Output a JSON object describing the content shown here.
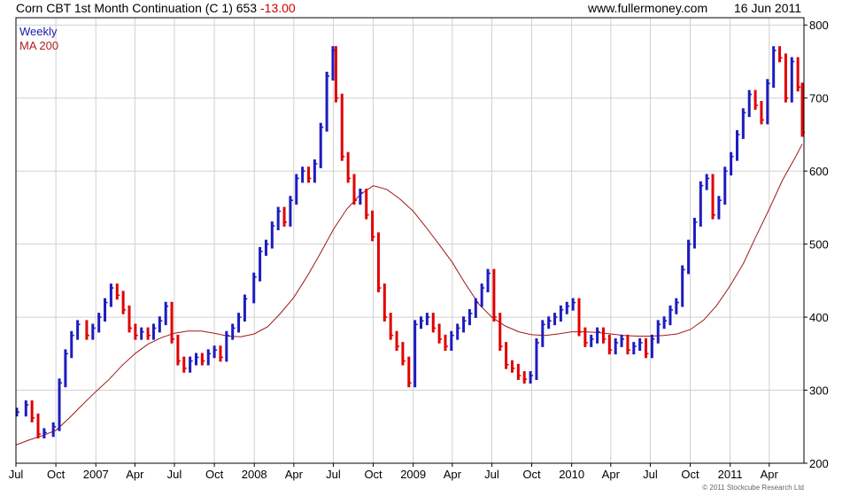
{
  "header": {
    "title": "Corn CBT 1st Month Continuation (C 1) 653",
    "change": "-13.00",
    "site": "www.fullermoney.com",
    "date": "16 Jun 2011"
  },
  "footer": {
    "copyright": "© 2011 Stockcube Research Ltd"
  },
  "colors": {
    "up": "#1c1cc0",
    "down": "#e00000",
    "ma": "#a01818",
    "grid": "#d0d0d0",
    "frame": "#000000"
  },
  "chart_data": {
    "type": "ohlc",
    "legend": [
      "Weekly",
      "MA 200"
    ],
    "legend_position": "top-left",
    "grid": true,
    "y_axis_side": "right",
    "ylim": [
      200,
      810
    ],
    "yticks": [
      200,
      300,
      400,
      500,
      600,
      700,
      800
    ],
    "xlim": [
      "2006-07-01",
      "2011-06-20"
    ],
    "xticks": [
      {
        "label": "Jul",
        "date": "2006-07-01"
      },
      {
        "label": "Oct",
        "date": "2006-10-01"
      },
      {
        "label": "2007",
        "date": "2007-01-01"
      },
      {
        "label": "Apr",
        "date": "2007-04-01"
      },
      {
        "label": "Jul",
        "date": "2007-07-01"
      },
      {
        "label": "Oct",
        "date": "2007-10-01"
      },
      {
        "label": "2008",
        "date": "2008-01-01"
      },
      {
        "label": "Apr",
        "date": "2008-04-01"
      },
      {
        "label": "Jul",
        "date": "2008-07-01"
      },
      {
        "label": "Oct",
        "date": "2008-10-01"
      },
      {
        "label": "2009",
        "date": "2009-01-01"
      },
      {
        "label": "Apr",
        "date": "2009-04-01"
      },
      {
        "label": "Jul",
        "date": "2009-07-01"
      },
      {
        "label": "Oct",
        "date": "2009-10-01"
      },
      {
        "label": "2010",
        "date": "2010-01-01"
      },
      {
        "label": "Apr",
        "date": "2010-04-01"
      },
      {
        "label": "Jul",
        "date": "2010-07-01"
      },
      {
        "label": "Oct",
        "date": "2010-10-01"
      },
      {
        "label": "2011",
        "date": "2011-01-01"
      },
      {
        "label": "Apr",
        "date": "2011-04-01"
      }
    ],
    "price_series": {
      "name": "Weekly",
      "points": [
        [
          "2006-07-03",
          270
        ],
        [
          "2006-07-24",
          280
        ],
        [
          "2006-08-07",
          262
        ],
        [
          "2006-08-21",
          240
        ],
        [
          "2006-09-04",
          242
        ],
        [
          "2006-09-25",
          250
        ],
        [
          "2006-10-09",
          310
        ],
        [
          "2006-10-23",
          350
        ],
        [
          "2006-11-06",
          375
        ],
        [
          "2006-11-20",
          390
        ],
        [
          "2006-12-11",
          375
        ],
        [
          "2006-12-25",
          385
        ],
        [
          "2007-01-08",
          400
        ],
        [
          "2007-01-22",
          420
        ],
        [
          "2007-02-05",
          440
        ],
        [
          "2007-02-19",
          430
        ],
        [
          "2007-03-05",
          410
        ],
        [
          "2007-03-19",
          385
        ],
        [
          "2007-04-02",
          375
        ],
        [
          "2007-04-16",
          380
        ],
        [
          "2007-05-01",
          375
        ],
        [
          "2007-05-14",
          385
        ],
        [
          "2007-05-28",
          395
        ],
        [
          "2007-06-11",
          415
        ],
        [
          "2007-06-25",
          370
        ],
        [
          "2007-07-09",
          340
        ],
        [
          "2007-07-23",
          330
        ],
        [
          "2007-08-06",
          340
        ],
        [
          "2007-08-20",
          345
        ],
        [
          "2007-09-03",
          340
        ],
        [
          "2007-09-17",
          350
        ],
        [
          "2007-10-01",
          355
        ],
        [
          "2007-10-15",
          345
        ],
        [
          "2007-10-29",
          375
        ],
        [
          "2007-11-12",
          385
        ],
        [
          "2007-11-26",
          400
        ],
        [
          "2007-12-10",
          425
        ],
        [
          "2007-12-31",
          455
        ],
        [
          "2008-01-14",
          490
        ],
        [
          "2008-01-28",
          500
        ],
        [
          "2008-02-11",
          525
        ],
        [
          "2008-02-25",
          545
        ],
        [
          "2008-03-10",
          530
        ],
        [
          "2008-03-24",
          560
        ],
        [
          "2008-04-07",
          590
        ],
        [
          "2008-04-21",
          600
        ],
        [
          "2008-05-05",
          590
        ],
        [
          "2008-05-19",
          610
        ],
        [
          "2008-06-02",
          660
        ],
        [
          "2008-06-16",
          730
        ],
        [
          "2008-06-30",
          765
        ],
        [
          "2008-07-07",
          700
        ],
        [
          "2008-07-21",
          620
        ],
        [
          "2008-08-04",
          590
        ],
        [
          "2008-08-18",
          560
        ],
        [
          "2008-09-01",
          570
        ],
        [
          "2008-09-15",
          540
        ],
        [
          "2008-09-29",
          510
        ],
        [
          "2008-10-13",
          440
        ],
        [
          "2008-10-27",
          400
        ],
        [
          "2008-11-10",
          375
        ],
        [
          "2008-11-24",
          360
        ],
        [
          "2008-12-08",
          340
        ],
        [
          "2008-12-22",
          310
        ],
        [
          "2009-01-05",
          390
        ],
        [
          "2009-01-19",
          395
        ],
        [
          "2009-02-02",
          400
        ],
        [
          "2009-02-16",
          385
        ],
        [
          "2009-03-02",
          370
        ],
        [
          "2009-03-16",
          360
        ],
        [
          "2009-03-30",
          375
        ],
        [
          "2009-04-13",
          385
        ],
        [
          "2009-04-27",
          395
        ],
        [
          "2009-05-11",
          405
        ],
        [
          "2009-05-25",
          420
        ],
        [
          "2009-06-08",
          440
        ],
        [
          "2009-06-22",
          460
        ],
        [
          "2009-07-06",
          400
        ],
        [
          "2009-07-20",
          360
        ],
        [
          "2009-08-03",
          335
        ],
        [
          "2009-08-17",
          330
        ],
        [
          "2009-08-31",
          320
        ],
        [
          "2009-09-14",
          315
        ],
        [
          "2009-09-28",
          320
        ],
        [
          "2009-10-12",
          365
        ],
        [
          "2009-10-26",
          390
        ],
        [
          "2009-11-09",
          395
        ],
        [
          "2009-11-23",
          400
        ],
        [
          "2009-12-07",
          410
        ],
        [
          "2009-12-21",
          415
        ],
        [
          "2010-01-04",
          420
        ],
        [
          "2010-01-18",
          380
        ],
        [
          "2010-02-01",
          365
        ],
        [
          "2010-02-15",
          370
        ],
        [
          "2010-03-01",
          380
        ],
        [
          "2010-03-15",
          370
        ],
        [
          "2010-03-29",
          355
        ],
        [
          "2010-04-12",
          365
        ],
        [
          "2010-04-26",
          370
        ],
        [
          "2010-05-10",
          355
        ],
        [
          "2010-05-24",
          360
        ],
        [
          "2010-06-07",
          365
        ],
        [
          "2010-06-21",
          350
        ],
        [
          "2010-07-05",
          370
        ],
        [
          "2010-07-19",
          390
        ],
        [
          "2010-08-02",
          395
        ],
        [
          "2010-08-16",
          410
        ],
        [
          "2010-08-30",
          420
        ],
        [
          "2010-09-13",
          465
        ],
        [
          "2010-09-27",
          500
        ],
        [
          "2010-10-11",
          530
        ],
        [
          "2010-10-25",
          580
        ],
        [
          "2010-11-08",
          590
        ],
        [
          "2010-11-22",
          540
        ],
        [
          "2010-12-06",
          560
        ],
        [
          "2010-12-20",
          600
        ],
        [
          "2011-01-03",
          620
        ],
        [
          "2011-01-17",
          650
        ],
        [
          "2011-01-31",
          680
        ],
        [
          "2011-02-14",
          705
        ],
        [
          "2011-02-28",
          690
        ],
        [
          "2011-03-14",
          670
        ],
        [
          "2011-03-28",
          720
        ],
        [
          "2011-04-11",
          765
        ],
        [
          "2011-04-25",
          755
        ],
        [
          "2011-05-09",
          700
        ],
        [
          "2011-05-23",
          750
        ],
        [
          "2011-06-06",
          715
        ],
        [
          "2011-06-16",
          653
        ]
      ]
    },
    "ma_series": {
      "name": "MA 200",
      "points": [
        [
          "2006-07-01",
          225
        ],
        [
          "2006-08-01",
          232
        ],
        [
          "2006-09-01",
          238
        ],
        [
          "2006-10-01",
          245
        ],
        [
          "2006-11-01",
          262
        ],
        [
          "2006-12-01",
          280
        ],
        [
          "2007-01-01",
          298
        ],
        [
          "2007-02-01",
          315
        ],
        [
          "2007-03-01",
          333
        ],
        [
          "2007-04-01",
          350
        ],
        [
          "2007-05-01",
          363
        ],
        [
          "2007-06-01",
          372
        ],
        [
          "2007-07-01",
          378
        ],
        [
          "2007-08-01",
          381
        ],
        [
          "2007-09-01",
          381
        ],
        [
          "2007-10-01",
          378
        ],
        [
          "2007-11-01",
          374
        ],
        [
          "2007-12-01",
          373
        ],
        [
          "2008-01-01",
          377
        ],
        [
          "2008-02-01",
          387
        ],
        [
          "2008-03-01",
          405
        ],
        [
          "2008-04-01",
          427
        ],
        [
          "2008-05-01",
          455
        ],
        [
          "2008-06-01",
          487
        ],
        [
          "2008-07-01",
          520
        ],
        [
          "2008-08-01",
          548
        ],
        [
          "2008-09-01",
          568
        ],
        [
          "2008-10-01",
          580
        ],
        [
          "2008-11-01",
          575
        ],
        [
          "2008-12-01",
          562
        ],
        [
          "2009-01-01",
          545
        ],
        [
          "2009-02-01",
          522
        ],
        [
          "2009-03-01",
          500
        ],
        [
          "2009-04-01",
          475
        ],
        [
          "2009-05-01",
          446
        ],
        [
          "2009-06-01",
          418
        ],
        [
          "2009-07-01",
          400
        ],
        [
          "2009-08-01",
          388
        ],
        [
          "2009-09-01",
          380
        ],
        [
          "2009-10-01",
          376
        ],
        [
          "2009-11-01",
          375
        ],
        [
          "2009-12-01",
          377
        ],
        [
          "2010-01-01",
          380
        ],
        [
          "2010-02-01",
          380
        ],
        [
          "2010-03-01",
          379
        ],
        [
          "2010-04-01",
          377
        ],
        [
          "2010-05-01",
          375
        ],
        [
          "2010-06-01",
          374
        ],
        [
          "2010-07-01",
          374
        ],
        [
          "2010-08-01",
          375
        ],
        [
          "2010-09-01",
          377
        ],
        [
          "2010-10-01",
          383
        ],
        [
          "2010-11-01",
          396
        ],
        [
          "2010-12-01",
          416
        ],
        [
          "2011-01-01",
          443
        ],
        [
          "2011-02-01",
          474
        ],
        [
          "2011-03-01",
          510
        ],
        [
          "2011-04-01",
          548
        ],
        [
          "2011-05-01",
          587
        ],
        [
          "2011-06-01",
          620
        ],
        [
          "2011-06-16",
          637
        ]
      ]
    }
  }
}
